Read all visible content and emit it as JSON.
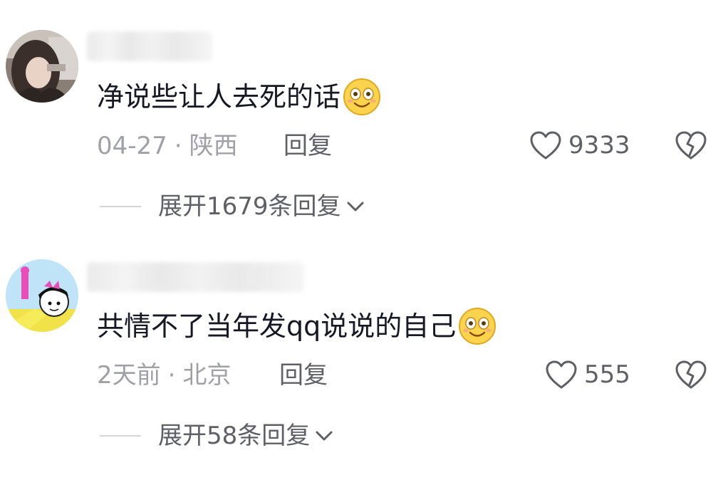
{
  "comments": [
    {
      "text": "净说些让人去死的话",
      "emoji_icon": "smiling-face-emoji",
      "time": "04-27",
      "location": "陕西",
      "reply_label": "回复",
      "likes": "9333",
      "expand_label": "展开1679条回复"
    },
    {
      "text": "共情不了当年发qq说说的自己",
      "emoji_icon": "smiling-face-emoji",
      "time": "2天前",
      "location": "北京",
      "reply_label": "回复",
      "likes": "555",
      "expand_label": "展开58条回复"
    }
  ],
  "separator": "·",
  "colors": {
    "text": "#161823",
    "meta": "#a0a1a6",
    "action": "#5f6066",
    "emoji": "#fcd34d"
  }
}
